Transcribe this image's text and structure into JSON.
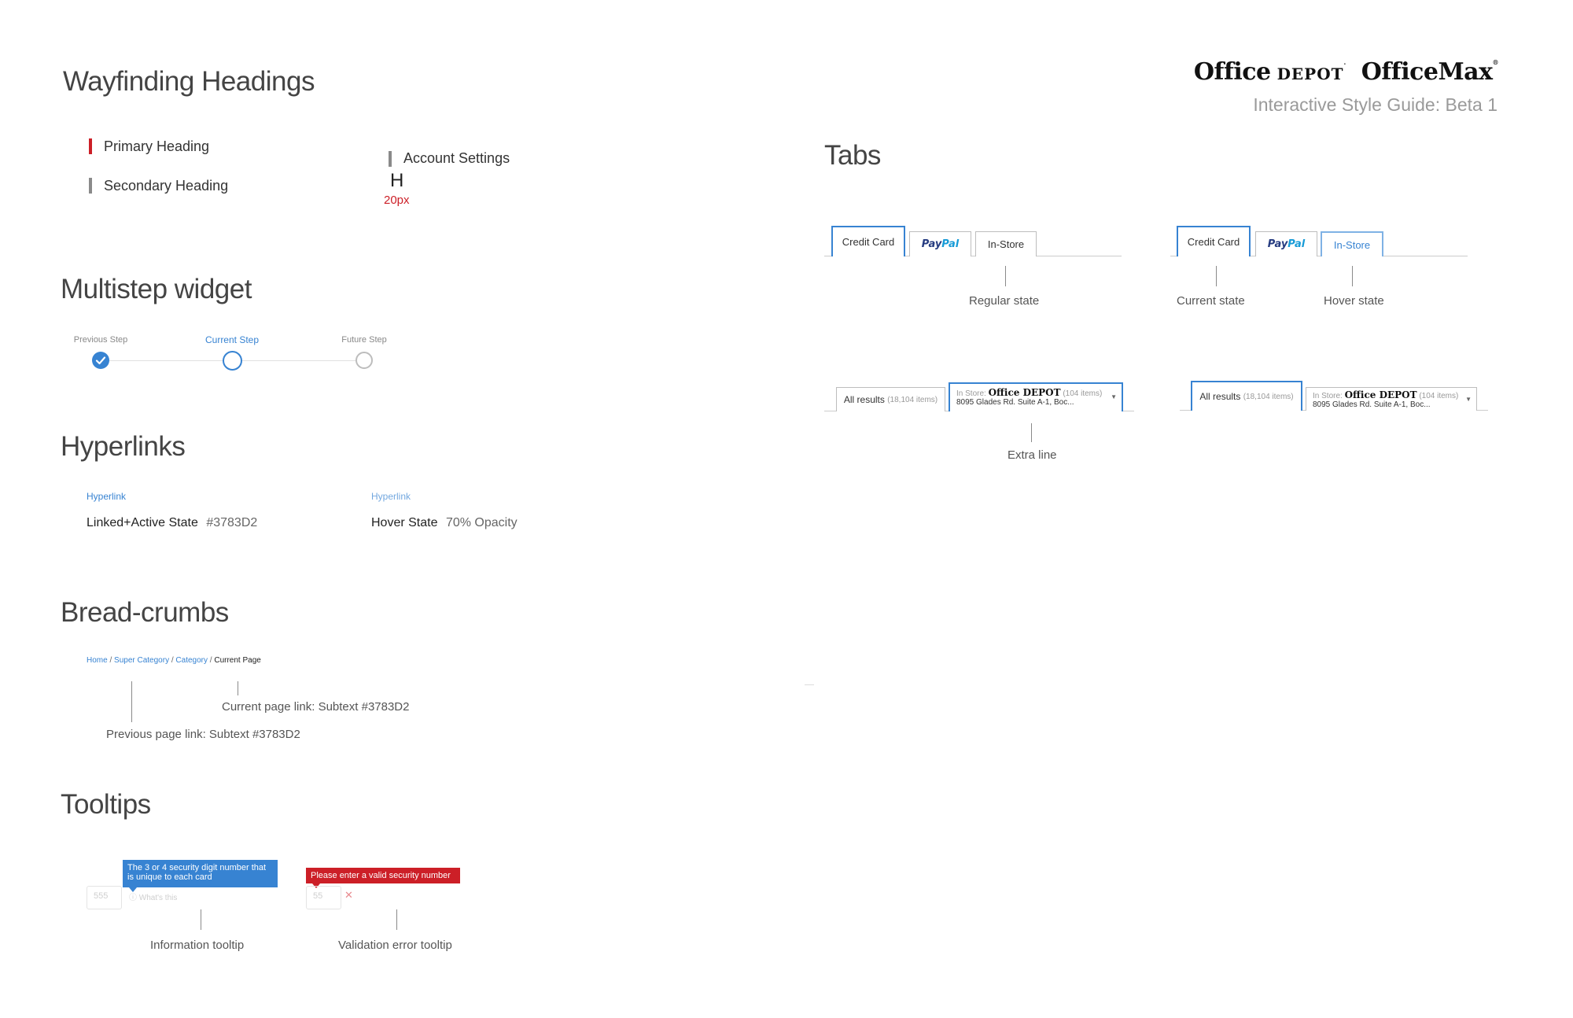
{
  "header": {
    "logo_part1": "Office",
    "logo_part2": "DEPOT",
    "logo_part3": "OfficeMax",
    "subtitle": "Interactive Style Guide: Beta 1"
  },
  "wayfinding": {
    "title": "Wayfinding Headings",
    "primary": "Primary Heading",
    "secondary": "Secondary Heading",
    "account": "Account Settings",
    "glyph": "H",
    "measure": "20px",
    "primary_color": "#cc1f27",
    "secondary_color": "#8a8a8a"
  },
  "multistep": {
    "title": "Multistep widget",
    "steps": [
      {
        "label": "Previous Step",
        "state": "done"
      },
      {
        "label": "Current Step",
        "state": "current"
      },
      {
        "label": "Future Step",
        "state": "future"
      }
    ]
  },
  "hyperlinks": {
    "title": "Hyperlinks",
    "sample1": "Hyperlink",
    "state1": "Linked+Active State",
    "value1": "#3783D2",
    "sample2": "Hyperlink",
    "state2": "Hover State",
    "value2": "70% Opacity",
    "link_color": "#3783D2"
  },
  "breadcrumbs": {
    "title": "Bread-crumbs",
    "items": [
      "Home",
      "Super Category",
      "Category"
    ],
    "separator": " / ",
    "current": "Current Page",
    "note_current": "Current page link: Subtext #3783D2",
    "note_previous": "Previous page link:  Subtext #3783D2"
  },
  "tooltips": {
    "title": "Tooltips",
    "info_text": "The 3 or 4 security digit number that is unique to each card",
    "info_input": "555",
    "info_help": "What's this",
    "error_text": "Please enter a valid security number",
    "error_input": "55",
    "error_icon": "close-icon",
    "label_info": "Information tooltip",
    "label_error": "Validation error tooltip",
    "info_color": "#3783D2",
    "error_color": "#cc1f27"
  },
  "tabs": {
    "title": "Tabs",
    "credit": "Credit Card",
    "paypal_1": "Pay",
    "paypal_2": "Pal",
    "instore": "In-Store",
    "regular_state": "Regular state",
    "current_state": "Current state",
    "hover_state": "Hover state",
    "all_results": "All results",
    "all_count": "(18,104 items)",
    "in_store_prefix": "In Store:",
    "store_name": "Office DEPOT",
    "store_count": "(104 items)",
    "store_address": "8095 Glades Rd. Suite A-1, Boc...",
    "extra_line": "Extra line",
    "accent": "#3783D2"
  }
}
